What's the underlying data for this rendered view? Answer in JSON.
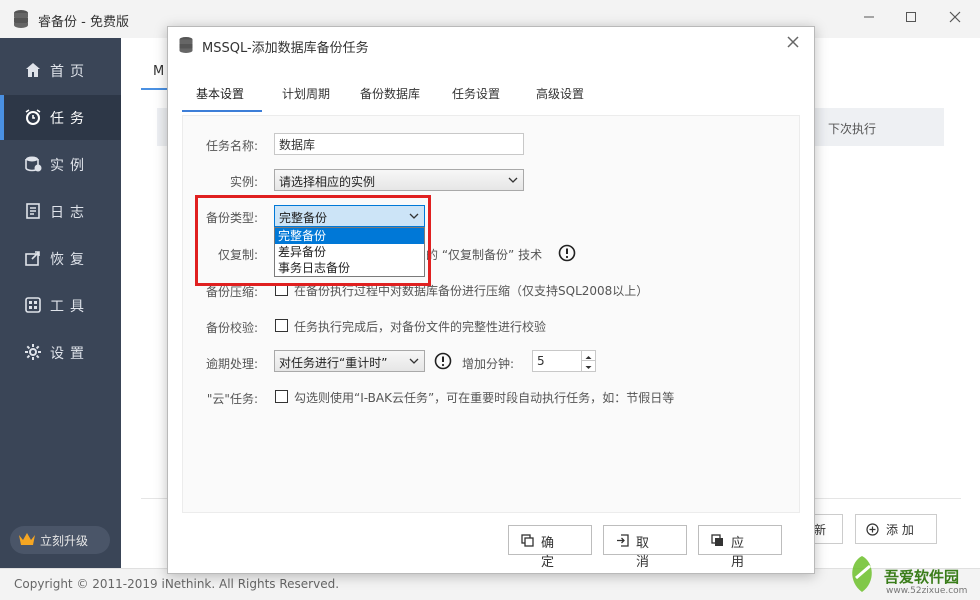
{
  "window": {
    "title": "睿备份 - 免费版",
    "controls": [
      "minimize-icon",
      "maximize-icon",
      "close-icon"
    ]
  },
  "sidebar": {
    "items": [
      {
        "label": "首页",
        "icon": "home-icon"
      },
      {
        "label": "任务",
        "icon": "alarm-clock-icon",
        "active": true
      },
      {
        "label": "实例",
        "icon": "database-icon"
      },
      {
        "label": "日志",
        "icon": "log-icon"
      },
      {
        "label": "恢复",
        "icon": "restore-icon"
      },
      {
        "label": "工具",
        "icon": "tools-icon"
      },
      {
        "label": "设置",
        "icon": "gear-icon"
      }
    ],
    "upgrade_label": "立刻升级"
  },
  "background": {
    "tab_label": "M",
    "column_next_run": "下次执行",
    "button_new": "新",
    "button_add": "添 加"
  },
  "footer": {
    "copyright": "Copyright © 2011-2019 iNethink. All Rights Reserved."
  },
  "watermark": {
    "text": "吾爱软件园",
    "url": "www.52zixue.com"
  },
  "dialog": {
    "title": "MSSQL-添加数据库备份任务",
    "tabs": [
      {
        "label": "基本设置",
        "active": true
      },
      {
        "label": "计划周期"
      },
      {
        "label": "备份数据库"
      },
      {
        "label": "任务设置"
      },
      {
        "label": "高级设置"
      }
    ],
    "fields": {
      "task_name": {
        "label": "任务名称:",
        "value": "数据库"
      },
      "instance": {
        "label": "实例:",
        "value": "请选择相应的实例"
      },
      "backup_type": {
        "label": "备份类型:",
        "value": "完整备份",
        "options": [
          "完整备份",
          "差异备份",
          "事务日志备份"
        ]
      },
      "copy_only": {
        "label": "仅复制:",
        "text_visible": "的 “仅复制备份” 技术"
      },
      "compression": {
        "label": "备份压缩:",
        "text": "在备份执行过程中对数据库备份进行压缩（仅支持SQL2008以上）"
      },
      "verify": {
        "label": "备份校验:",
        "text": "任务执行完成后，对备份文件的完整性进行校验"
      },
      "timeout": {
        "label": "逾期处理:",
        "value": "对任务进行“重计时”",
        "add_minutes_label": "增加分钟:",
        "add_minutes_value": "5"
      },
      "cloud": {
        "label": "\"云\"任务:",
        "text": "勾选则使用“I-BAK云任务”，可在重要时段自动执行任务，如：节假日等"
      }
    },
    "buttons": {
      "ok": "确 定",
      "cancel": "取 消",
      "apply": "应 用"
    }
  },
  "colors": {
    "sidebar_bg": "#3a4557",
    "accent": "#3d7ed8",
    "highlight_box": "#e02020",
    "dropdown_selected": "#0078d7"
  }
}
